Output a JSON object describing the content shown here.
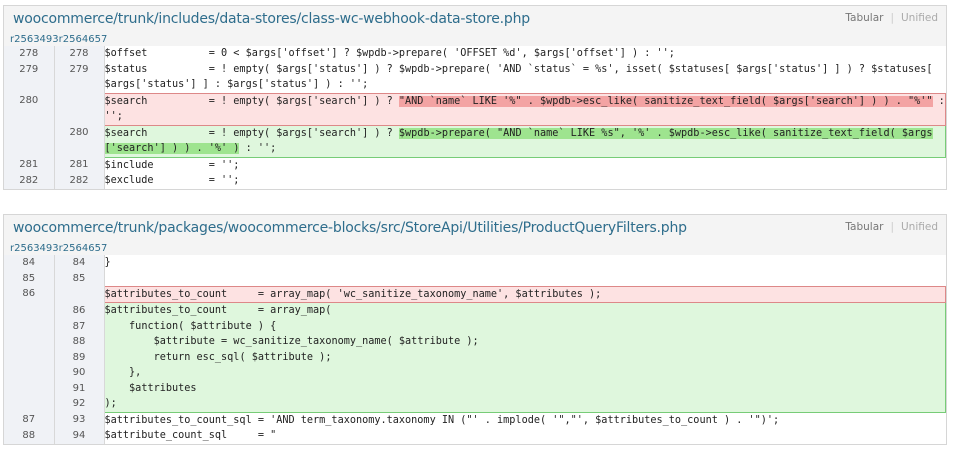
{
  "view_toggle": {
    "tabular": "Tabular",
    "unified": "Unified"
  },
  "diffs": [
    {
      "file_path": "woocommerce/trunk/includes/data-stores/class-wc-webhook-data-store.php",
      "revisions": [
        "r2563493",
        "r2564657"
      ],
      "rows": [
        {
          "type": "ctx",
          "old": "278",
          "new": "278",
          "code": "$offset          = 0 < $args['offset'] ? $wpdb->prepare( 'OFFSET %d', $args['offset'] ) : '';"
        },
        {
          "type": "ctx",
          "old": "279",
          "new": "279",
          "code": "$status          = ! empty( $args['status'] ) ? $wpdb->prepare( 'AND `status` = %s', isset( $statuses[ $args['status'] ] ) ? $statuses[ $args['status'] ] : $args['status'] ) : '';"
        },
        {
          "type": "del",
          "old": "280",
          "new": "",
          "pre": "$search          = ! empty( $args['search'] ) ? ",
          "hl": "\"AND `name` LIKE '%\" . $wpdb->esc_like( sanitize_text_field( $args['search'] ) ) . \"%'\"",
          "post": " : '';"
        },
        {
          "type": "add",
          "old": "",
          "new": "280",
          "pre": "$search          = ! empty( $args['search'] ) ? ",
          "hl": "$wpdb->prepare( \"AND `name` LIKE %s\", '%' . $wpdb->esc_like( sanitize_text_field( $args['search'] ) ) . '%' )",
          "post": " : '';"
        },
        {
          "type": "ctx",
          "old": "281",
          "new": "281",
          "code": "$include         = '';"
        },
        {
          "type": "ctx",
          "old": "282",
          "new": "282",
          "code": "$exclude         = '';"
        }
      ]
    },
    {
      "file_path": "woocommerce/trunk/packages/woocommerce-blocks/src/StoreApi/Utilities/ProductQueryFilters.php",
      "revisions": [
        "r2563493",
        "r2564657"
      ],
      "rows": [
        {
          "type": "ctx",
          "old": "84",
          "new": "84",
          "code": "}"
        },
        {
          "type": "ctx",
          "old": "85",
          "new": "85",
          "code": ""
        },
        {
          "type": "del",
          "old": "86",
          "new": "",
          "code": "$attributes_to_count     = array_map( 'wc_sanitize_taxonomy_name', $attributes );"
        },
        {
          "type": "add",
          "old": "",
          "new": "86",
          "code": "$attributes_to_count     = array_map("
        },
        {
          "type": "add",
          "old": "",
          "new": "87",
          "code": "    function( $attribute ) {"
        },
        {
          "type": "add",
          "old": "",
          "new": "88",
          "code": "        $attribute = wc_sanitize_taxonomy_name( $attribute );"
        },
        {
          "type": "add",
          "old": "",
          "new": "89",
          "code": "        return esc_sql( $attribute );"
        },
        {
          "type": "add",
          "old": "",
          "new": "90",
          "code": "    },"
        },
        {
          "type": "add",
          "old": "",
          "new": "91",
          "code": "    $attributes"
        },
        {
          "type": "add",
          "old": "",
          "new": "92",
          "code": ");"
        },
        {
          "type": "ctx",
          "old": "87",
          "new": "93",
          "code": "$attributes_to_count_sql = 'AND term_taxonomy.taxonomy IN (\"' . implode( '\",\"', $attributes_to_count ) . '\")';"
        },
        {
          "type": "ctx",
          "old": "88",
          "new": "94",
          "code": "$attribute_count_sql     = \""
        }
      ]
    }
  ]
}
